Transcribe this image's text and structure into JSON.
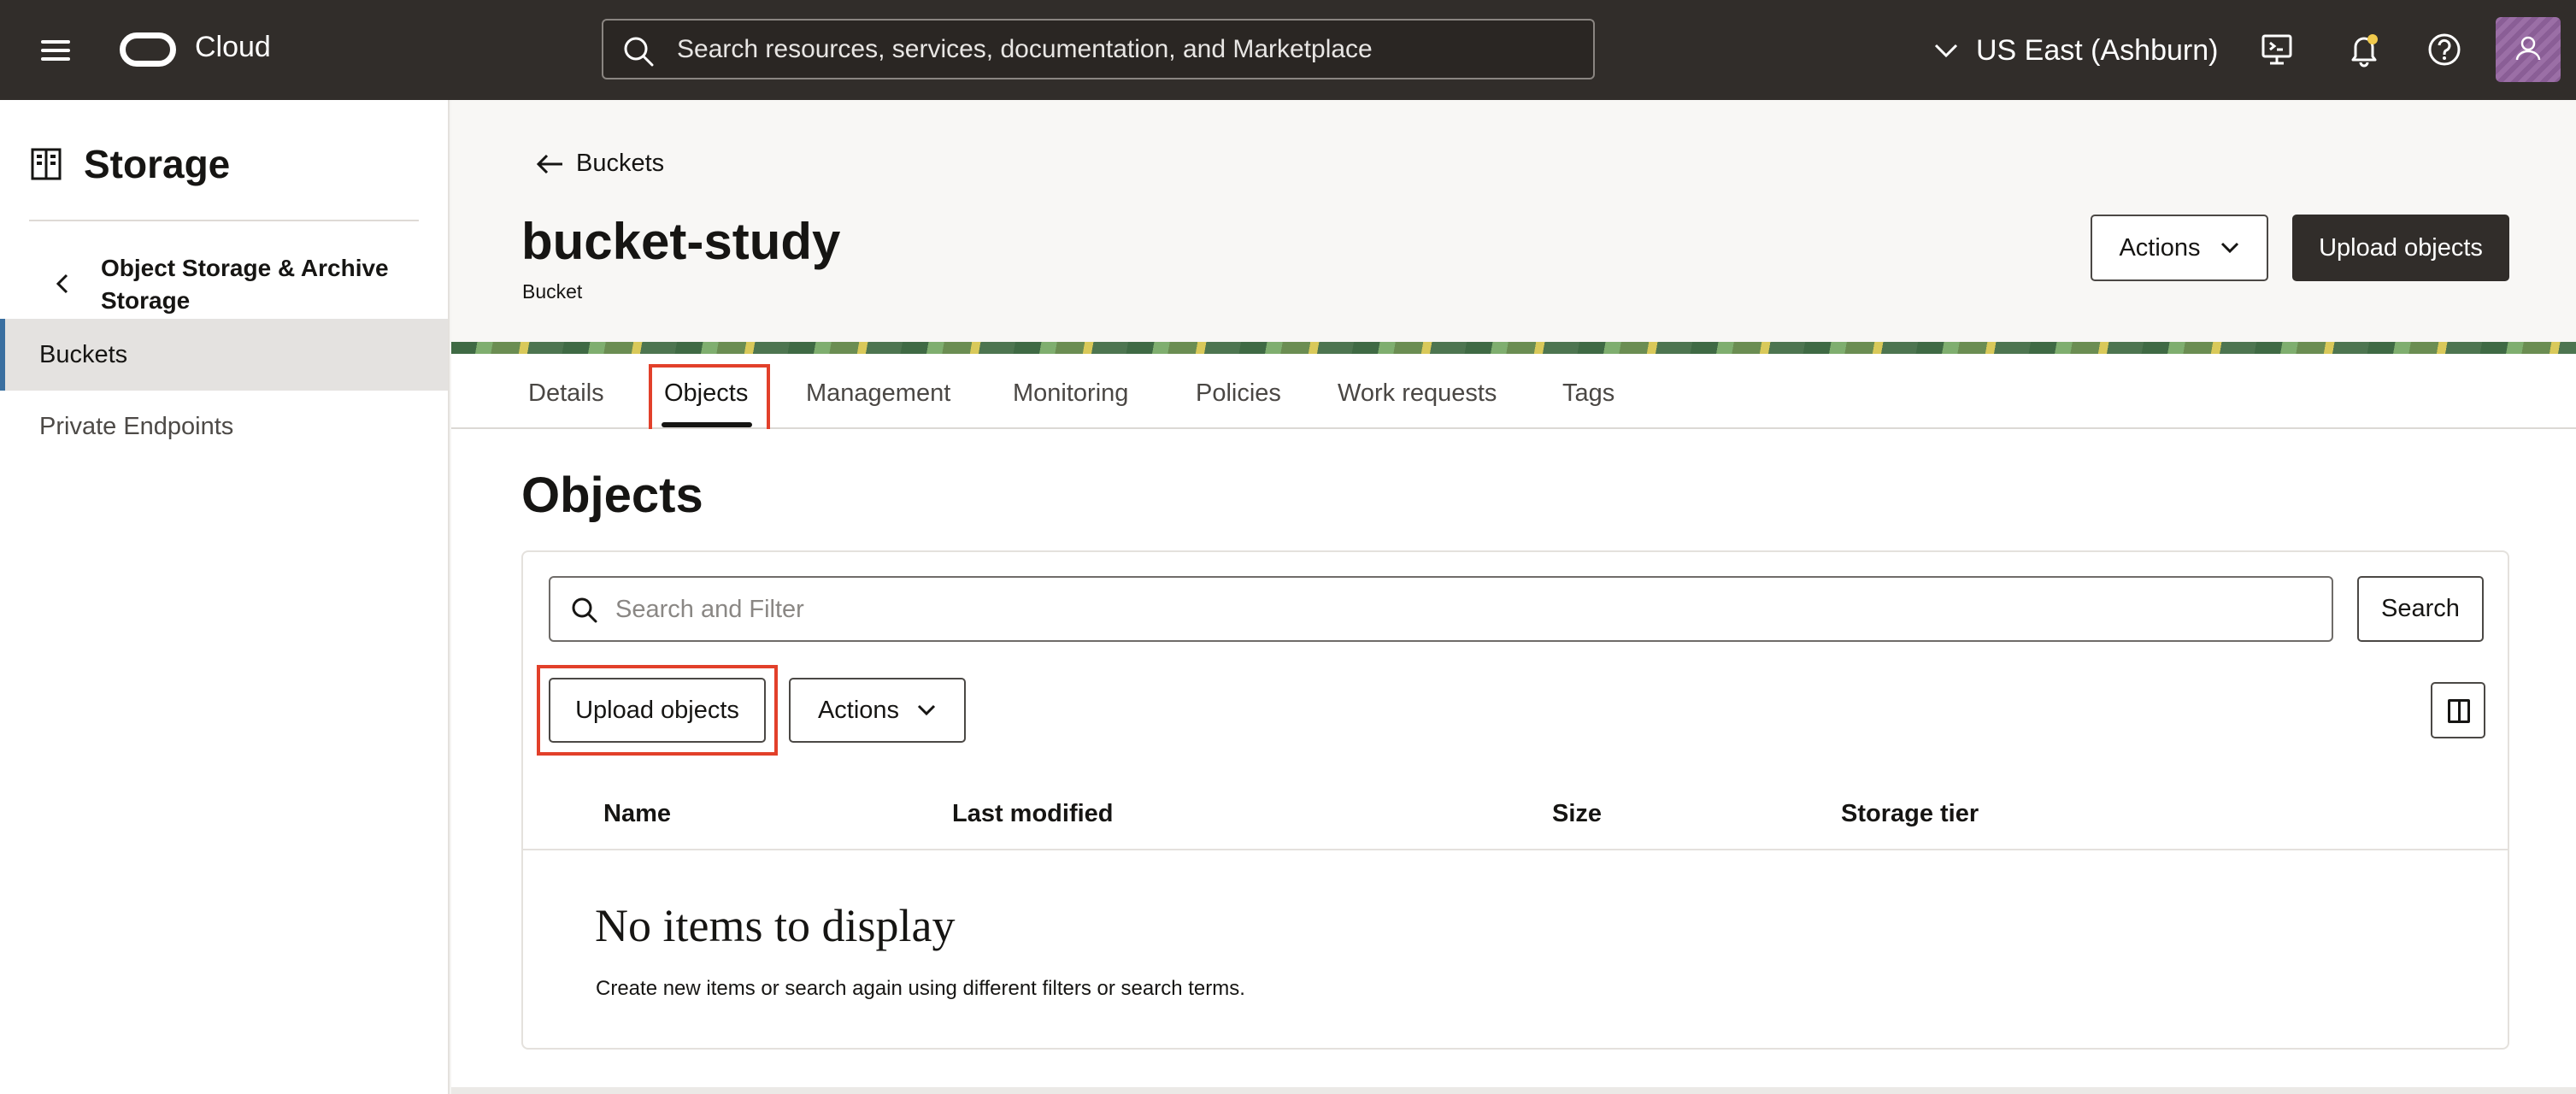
{
  "topbar": {
    "brand": "Cloud",
    "search_placeholder": "Search resources, services, documentation, and Marketplace",
    "region": "US East (Ashburn)",
    "icons": [
      "menu-icon",
      "cloud-logo-icon",
      "search-icon",
      "chevron-down-icon",
      "cloud-shell-icon",
      "bell-icon",
      "help-icon",
      "user-icon"
    ]
  },
  "sidebar": {
    "title": "Storage",
    "parent_link": "Object Storage & Archive Storage",
    "items": [
      {
        "label": "Buckets",
        "active": true
      },
      {
        "label": "Private Endpoints",
        "active": false
      }
    ]
  },
  "header": {
    "back_label": "Buckets",
    "title": "bucket-study",
    "subtitle": "Bucket",
    "actions_label": "Actions",
    "upload_label": "Upload objects"
  },
  "tabs": [
    {
      "label": "Details"
    },
    {
      "label": "Objects",
      "active": true
    },
    {
      "label": "Management"
    },
    {
      "label": "Monitoring"
    },
    {
      "label": "Policies"
    },
    {
      "label": "Work requests"
    },
    {
      "label": "Tags"
    }
  ],
  "objects": {
    "title": "Objects",
    "filter_placeholder": "Search and Filter",
    "search_label": "Search",
    "upload_label": "Upload objects",
    "actions_label": "Actions",
    "columns": [
      "Name",
      "Last modified",
      "Size",
      "Storage tier"
    ],
    "empty_title": "No items to display",
    "empty_text": "Create new items or search again using different filters or search terms."
  },
  "colors": {
    "topbar": "#312d2a",
    "highlight": "#e2402a",
    "active_nav_accent": "#3a6fa0"
  }
}
